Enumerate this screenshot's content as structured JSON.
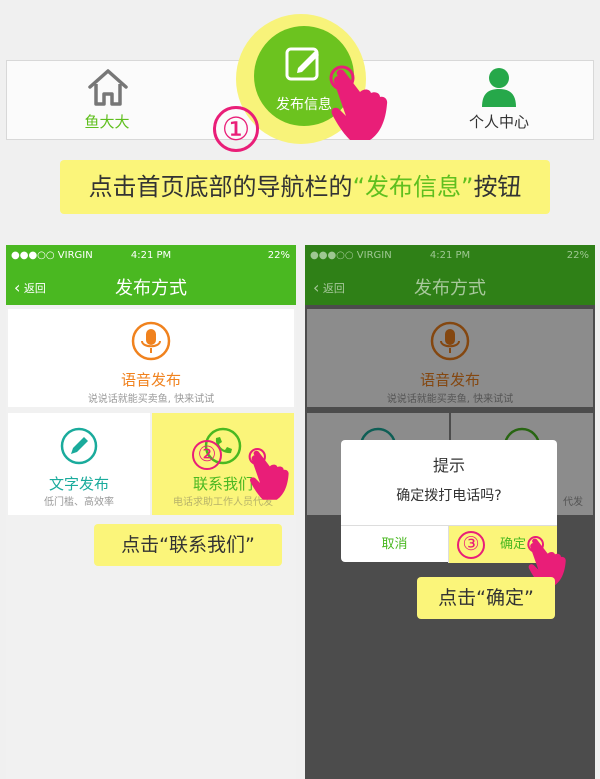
{
  "section1": {
    "nav_home_label": "鱼大大",
    "nav_publish_label": "发布信息",
    "nav_me_label": "个人中心",
    "step_number": "①",
    "callout_prefix": "点击首页底部的导航栏的",
    "callout_quoted": "“发布信息”",
    "callout_suffix": "按钮"
  },
  "phone_left": {
    "carrier": "●●●○○ VIRGIN",
    "time": "4:21 PM",
    "battery": "22%",
    "back_label": "返回",
    "title": "发布方式",
    "voice": {
      "title": "语音发布",
      "subtitle": "说说话就能买卖鱼, 快来试试"
    },
    "text": {
      "title": "文字发布",
      "subtitle": "低门槛、高效率"
    },
    "contact": {
      "title": "联系我们",
      "subtitle": "电话求助工作人员代发"
    },
    "step_number": "②",
    "callout": "点击“联系我们”"
  },
  "phone_right": {
    "carrier": "●●●○○ VIRGIN",
    "time": "4:21 PM",
    "battery": "22%",
    "back_label": "返回",
    "title": "发布方式",
    "voice": {
      "title": "语音发布",
      "subtitle": "说说话就能买卖鱼, 快来试试"
    },
    "dialog": {
      "title": "提示",
      "message": "确定拨打电话吗?",
      "cancel": "取消",
      "ok": "确定"
    },
    "side_text": "代发",
    "step_number": "③",
    "callout": "点击“确定”"
  },
  "colors": {
    "brand_green": "#4ab821",
    "highlight_yellow": "#fbf57a",
    "step_pink": "#e91e78",
    "voice_orange": "#f0821e",
    "text_teal": "#1aab9c"
  }
}
